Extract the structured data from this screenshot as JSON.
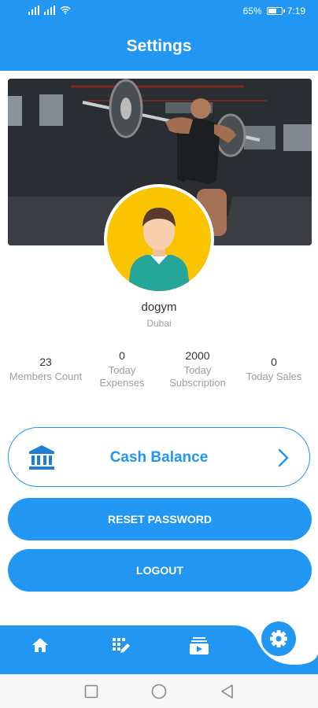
{
  "status_bar": {
    "battery": "65%",
    "time": "7:19",
    "battery_level": 0.65
  },
  "app_bar": {
    "title": "Settings"
  },
  "profile": {
    "name": "dogym",
    "location": "Dubai"
  },
  "stats": [
    {
      "value": "23",
      "label": "Members Count"
    },
    {
      "value": "0",
      "label": "Today Expenses"
    },
    {
      "value": "2000",
      "label": "Today Subscription"
    },
    {
      "value": "0",
      "label": "Today Sales"
    }
  ],
  "cash_balance": {
    "label": "Cash Balance"
  },
  "buttons": {
    "reset_password": "RESET PASSWORD",
    "logout": "LOGOUT"
  },
  "bottom_nav": {
    "items": [
      {
        "icon": "home-icon"
      },
      {
        "icon": "dialpad-edit-icon"
      },
      {
        "icon": "video-stack-icon"
      }
    ],
    "fab_icon": "gear-icon"
  },
  "system_nav": {
    "items": [
      "recent-apps-icon",
      "home-circle-icon",
      "back-icon"
    ]
  },
  "colors": {
    "primary": "#2196f3",
    "avatar_bg": "#fbc400",
    "muted_text": "#9e9e9e"
  }
}
